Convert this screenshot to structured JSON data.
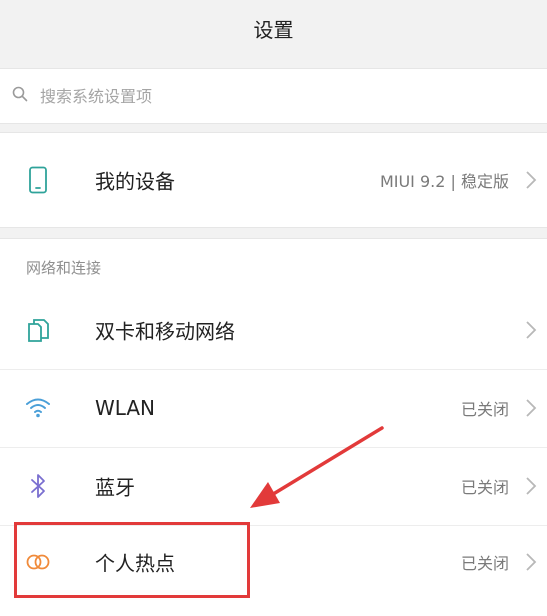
{
  "header": {
    "title": "设置"
  },
  "search": {
    "placeholder": "搜索系统设置项",
    "icon": "search-icon"
  },
  "device_item": {
    "label": "我的设备",
    "value": "MIUI 9.2 | 稳定版",
    "icon": "phone-icon"
  },
  "network_section": {
    "title": "网络和连接",
    "items": [
      {
        "label": "双卡和移动网络",
        "value": "",
        "icon": "sim-card-icon"
      },
      {
        "label": "WLAN",
        "value": "已关闭",
        "icon": "wifi-icon"
      },
      {
        "label": "蓝牙",
        "value": "已关闭",
        "icon": "bluetooth-icon"
      },
      {
        "label": "个人热点",
        "value": "已关闭",
        "icon": "hotspot-icon"
      }
    ]
  },
  "colors": {
    "accent_teal": "#2fa39a",
    "wifi_blue": "#4a9fd8",
    "bluetooth_purple": "#7a6fd0",
    "hotspot_orange": "#f08a3a",
    "annotation_red": "#e23a3a"
  }
}
